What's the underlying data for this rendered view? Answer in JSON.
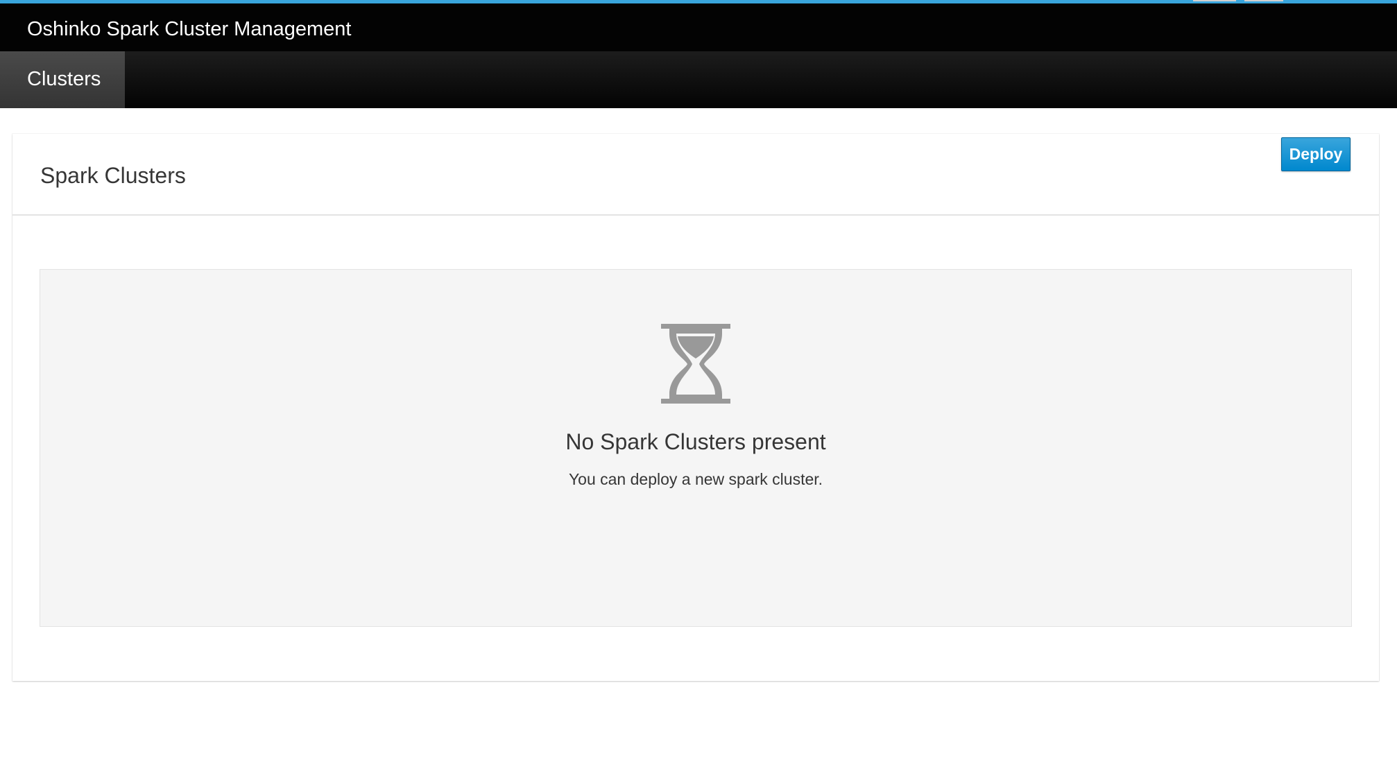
{
  "app": {
    "title": "Oshinko Spark Cluster Management",
    "accent_color": "#39a5dc"
  },
  "nav": {
    "tabs": [
      {
        "label": "Clusters",
        "active": true
      }
    ]
  },
  "page": {
    "title": "Spark Clusters",
    "deploy_label": "Deploy",
    "button_color": "#0088ce"
  },
  "empty_state": {
    "icon": "hourglass-icon",
    "title": "No Spark Clusters present",
    "help_text": "You can deploy a new spark cluster."
  }
}
